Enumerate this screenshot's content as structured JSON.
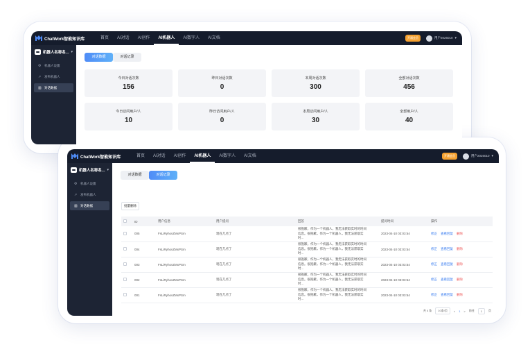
{
  "app": {
    "logo_text": "ChatWork智能知识库",
    "nav": [
      "首页",
      "AI对话",
      "AI创作",
      "AI机器人",
      "AI数字人",
      "AI文档"
    ],
    "active_nav": "AI机器人",
    "badge": "开通会员",
    "user_name": "用户2026010"
  },
  "sidebar": {
    "bot_name": "机器人名称名...",
    "items": [
      "机器人设置",
      "发布机器人",
      "对话数据"
    ]
  },
  "tabs": [
    "对话数据",
    "对话记录"
  ],
  "stats": [
    {
      "label": "今日对话次数",
      "value": "156"
    },
    {
      "label": "昨日对话次数",
      "value": "0"
    },
    {
      "label": "本周对话次数",
      "value": "300"
    },
    {
      "label": "全部对话次数",
      "value": "456"
    },
    {
      "label": "今日访问用户/人",
      "value": "10"
    },
    {
      "label": "昨日访问用户/人",
      "value": "0"
    },
    {
      "label": "本周访问用户/人",
      "value": "30"
    },
    {
      "label": "全部用户/人",
      "value": "40"
    }
  ],
  "records": {
    "batch_delete": "批量删除",
    "columns": [
      "ID",
      "用户信息",
      "用户提问",
      "回答",
      "提问时间",
      "操作"
    ],
    "rows": [
      {
        "id": "005",
        "user": "FsLiRyhovZMxPSm",
        "question": "现在几点了",
        "answer": "很抱歉，作为一个机器人，我无法获取实时的时间信息。很抱歉，作为一个机器人，我无法获取实时...",
        "time": "2023-04-10 03:03:54"
      },
      {
        "id": "004",
        "user": "FsLiRyhovZMxPSm",
        "question": "现在几点了",
        "answer": "很抱歉，作为一个机器人，我无法获取实时的时间信息。很抱歉，作为一个机器人，我无法获取实时...",
        "time": "2023-04-10 03:03:54"
      },
      {
        "id": "003",
        "user": "FsLiRyhovZMxPSm",
        "question": "现在几点了",
        "answer": "很抱歉，作为一个机器人，我无法获取实时的时间信息。很抱歉，作为一个机器人，我无法获取实时...",
        "time": "2023-04-10 03:03:54"
      },
      {
        "id": "002",
        "user": "FsLiRyhovZMxPSm",
        "question": "现在几点了",
        "answer": "很抱歉，作为一个机器人，我无法获取实时的时间信息。很抱歉，作为一个机器人，我无法获取实时...",
        "time": "2023-04-10 03:03:54"
      },
      {
        "id": "001",
        "user": "FsLiRyhovZMxPSm",
        "question": "现在几点了",
        "answer": "很抱歉，作为一个机器人，我无法获取实时的时间信息。很抱歉，作为一个机器人，我无法获取实时...",
        "time": "2023-04-10 03:03:54"
      }
    ],
    "actions": [
      "修正",
      "查看回复",
      "删除"
    ],
    "pagination": {
      "total": "共 4 条",
      "page_size": "10条/页",
      "prev": "<",
      "current": "1",
      "next": ">",
      "goto_label": "前往",
      "goto_value": "1",
      "page_unit": "页"
    }
  },
  "colors": {
    "topbar": "#151c2c",
    "sidebar": "#1d2434",
    "accent": "#4f8cf7",
    "danger": "#ee5a5a",
    "badge": "#f5a130"
  }
}
